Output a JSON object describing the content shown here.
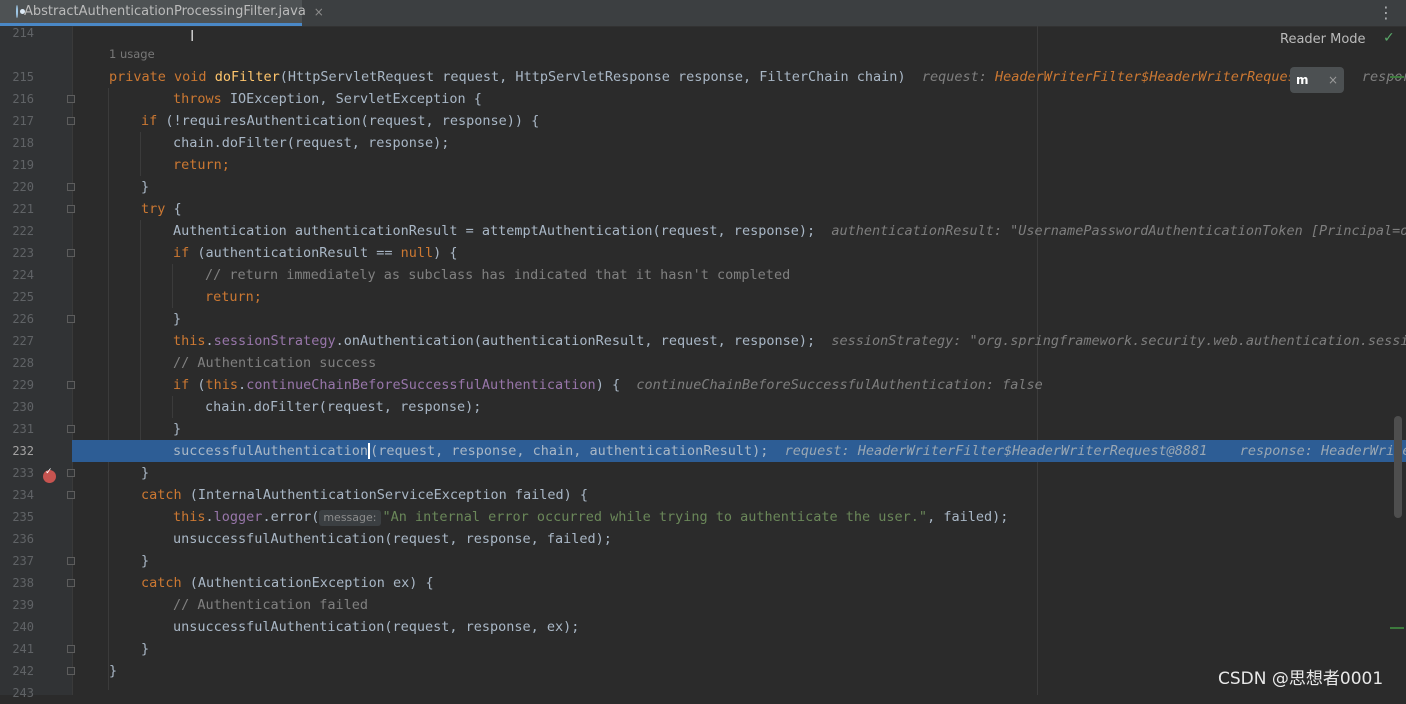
{
  "tab": {
    "filename": "AbstractAuthenticationProcessingFilter.java",
    "close": "×",
    "menu": "⋮"
  },
  "editor": {
    "usage_hint": "1 usage",
    "reader_mode": "Reader Mode",
    "check_icon": "✓",
    "popup_icon_label": "m",
    "popup_close": "×"
  },
  "line_numbers": [
    "214",
    "215",
    "216",
    "217",
    "218",
    "219",
    "220",
    "221",
    "222",
    "223",
    "224",
    "225",
    "226",
    "227",
    "228",
    "229",
    "230",
    "231",
    "232",
    "233",
    "234",
    "235",
    "236",
    "237",
    "238",
    "239",
    "240",
    "241",
    "242",
    "243"
  ],
  "current_line": "232",
  "code": {
    "l215": {
      "kw1": "private",
      "kw2": "void",
      "fn": "doFilter",
      "rest": "(HttpServletRequest request, HttpServletResponse response, FilterChain chain)",
      "inl_label": "request: ",
      "inl_value": "HeaderWriterFilter$HeaderWriterRequest",
      "inl_tail": "respor"
    },
    "l216": {
      "kw": "throws",
      "rest": " IOException, ServletException {"
    },
    "l217": {
      "kw": "if",
      "rest": " (!requiresAuthentication(request, response)) {"
    },
    "l218": {
      "text": "chain.doFilter(request, response);"
    },
    "l219": {
      "kw": "return",
      "rest": ";"
    },
    "l220": {
      "text": "}"
    },
    "l221": {
      "kw": "try",
      "rest": " {"
    },
    "l222": {
      "text": "Authentication authenticationResult = attemptAuthentication(request, response);",
      "inl": "authenticationResult: \"UsernamePasswordAuthenticationToken [Principal=org"
    },
    "l223": {
      "kw": "if",
      "mid": " (authenticationResult == ",
      "kw2": "null",
      "rest": ") {"
    },
    "l224": {
      "cmt": "// return immediately as subclass has indicated that it hasn't completed"
    },
    "l225": {
      "kw": "return",
      "rest": ";"
    },
    "l226": {
      "text": "}"
    },
    "l227": {
      "kw": "this",
      "fld": "sessionStrategy",
      "rest": ".onAuthentication(authenticationResult, request, response);",
      "inl": "sessionStrategy: \"org.springframework.security.web.authentication.session"
    },
    "l228": {
      "cmt": "// Authentication success"
    },
    "l229": {
      "kw": "if",
      "kw_this": "this",
      "fld": "continueChainBeforeSuccessfulAuthentication",
      "rest": ") {",
      "inl": "continueChainBeforeSuccessfulAuthentication: false"
    },
    "l230": {
      "text": "chain.doFilter(request, response);"
    },
    "l231": {
      "text": "}"
    },
    "l232": {
      "call": "successfulAuthentication",
      "rest": "(request, response, chain, authenticationResult);",
      "inl1": "request: HeaderWriterFilter$HeaderWriterRequest@8881",
      "inl2": "response: HeaderWriterR"
    },
    "l233": {
      "text": "}"
    },
    "l234": {
      "kw": "catch",
      "rest": " (InternalAuthenticationServiceException failed) {"
    },
    "l235": {
      "kw": "this",
      "fld": "logger",
      "mid": ".error(",
      "hint": "message:",
      "str": "\"An internal error occurred while trying to authenticate the user.\"",
      "rest": ", failed);"
    },
    "l236": {
      "text": "unsuccessfulAuthentication(request, response, failed);"
    },
    "l237": {
      "text": "}"
    },
    "l238": {
      "kw": "catch",
      "rest": " (AuthenticationException ex) {"
    },
    "l239": {
      "cmt": "// Authentication failed"
    },
    "l240": {
      "text": "unsuccessfulAuthentication(request, response, ex);"
    },
    "l241": {
      "text": "}"
    },
    "l242": {
      "text": "}"
    }
  },
  "watermark": "CSDN @思想者0001",
  "colors": {
    "background": "#2b2b2b",
    "keyword": "#cc7832",
    "function": "#ffc66d",
    "field": "#9876aa",
    "string": "#6a8759",
    "comment": "#808080",
    "selection": "#2d5d95",
    "breakpoint": "#c75450"
  }
}
